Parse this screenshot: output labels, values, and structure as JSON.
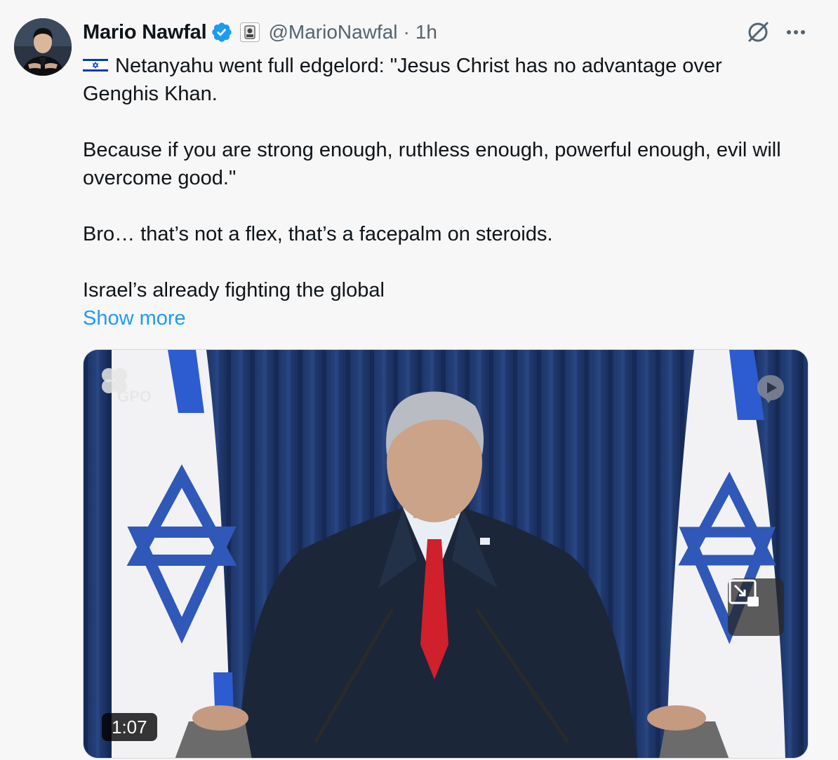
{
  "author": {
    "display_name": "Mario Nawfal",
    "handle": "@MarioNawfal",
    "separator": "·",
    "time": "1h"
  },
  "icons": {
    "verified": "verified-badge-icon",
    "affiliation": "affiliate-badge-icon",
    "grok": "grok-icon",
    "more": "more-options-icon",
    "flag": "israel-flag-icon",
    "pip": "picture-in-picture-icon"
  },
  "tweet": {
    "line1": "Netanyahu went full edgelord: \"Jesus Christ has no advantage over Genghis Khan.",
    "line2": "Because if you are strong enough, ruthless enough, powerful enough, evil will overcome good.\"",
    "line3": "Bro… that’s not a flex, that’s a facepalm on steroids.",
    "line4": "Israel’s already fighting the global",
    "show_more": "Show more"
  },
  "media": {
    "watermark": "GPO",
    "duration": "1:07"
  },
  "colors": {
    "link": "#1d9bf0",
    "secondary_text": "#536471",
    "verified": "#1d9bf0",
    "background": "#f7f7f7"
  }
}
